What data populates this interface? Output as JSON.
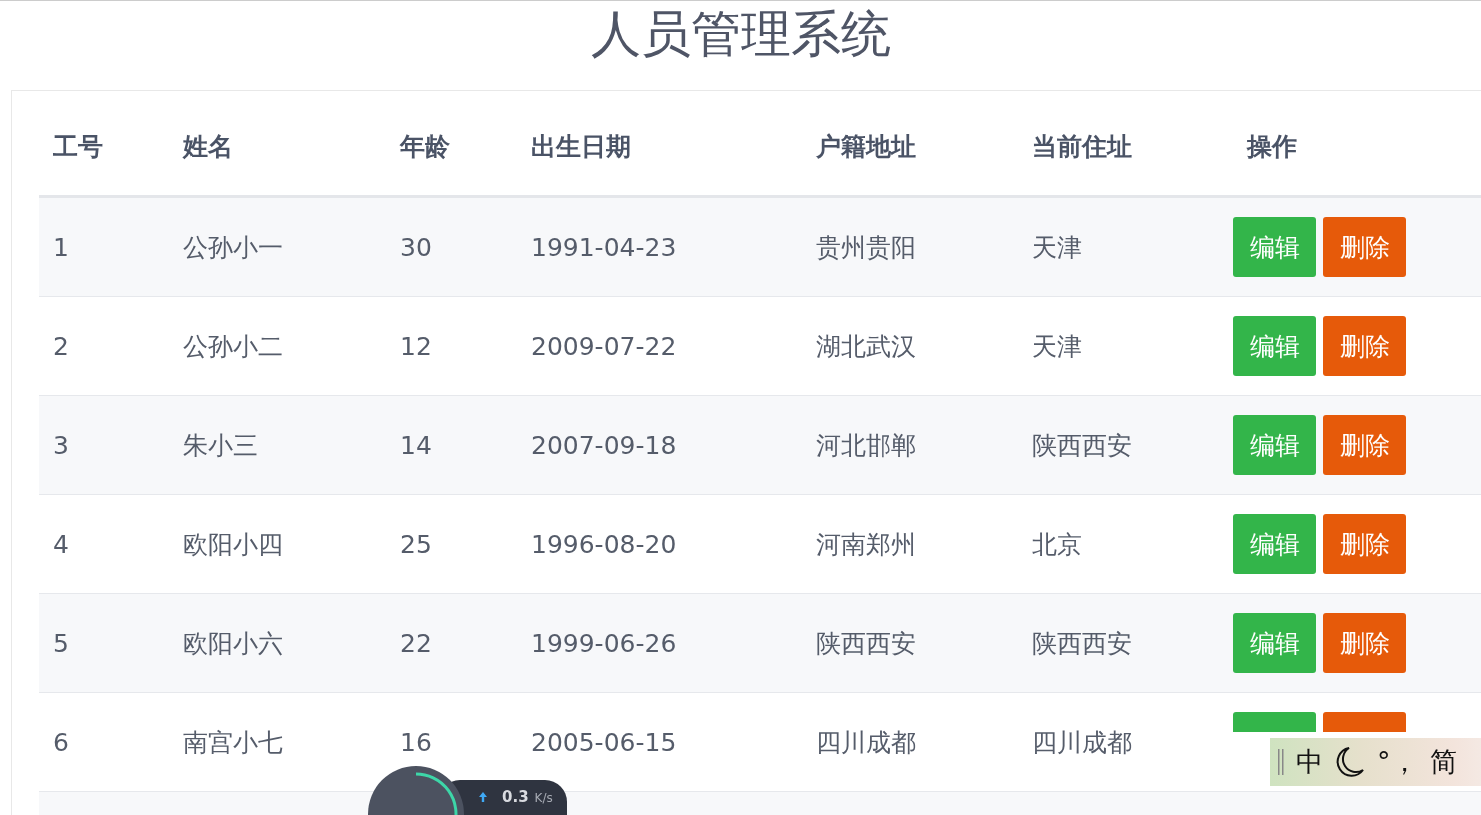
{
  "title": "人员管理系统",
  "table": {
    "columns": [
      "工号",
      "姓名",
      "年龄",
      "出生日期",
      "户籍地址",
      "当前住址",
      "操作"
    ],
    "rows": [
      {
        "cells": [
          "1",
          "公孙小一",
          "30",
          "1991-04-23",
          "贵州贵阳",
          "天津"
        ],
        "actions": [
          "编辑",
          "删除"
        ]
      },
      {
        "cells": [
          "2",
          "公孙小二",
          "12",
          "2009-07-22",
          "湖北武汉",
          "天津"
        ],
        "actions": [
          "编辑",
          "删除"
        ]
      },
      {
        "cells": [
          "3",
          "朱小三",
          "14",
          "2007-09-18",
          "河北邯郸",
          "陕西西安"
        ],
        "actions": [
          "编辑",
          "删除"
        ]
      },
      {
        "cells": [
          "4",
          "欧阳小四",
          "25",
          "1996-08-20",
          "河南郑州",
          "北京"
        ],
        "actions": [
          "编辑",
          "删除"
        ]
      },
      {
        "cells": [
          "5",
          "欧阳小六",
          "22",
          "1999-06-26",
          "陕西西安",
          "陕西西安"
        ],
        "actions": [
          "编辑",
          "删除"
        ]
      },
      {
        "cells": [
          "6",
          "南宫小七",
          "16",
          "2005-06-15",
          "四川成都",
          "四川成都"
        ]
      }
    ]
  },
  "speed_widget": {
    "upload": "0.3",
    "unit": "K/s"
  },
  "ime_bar": {
    "mode": "中",
    "punctuation": "°，",
    "script": "简"
  }
}
